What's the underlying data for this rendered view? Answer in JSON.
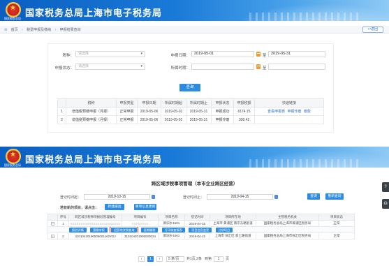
{
  "brand": {
    "title": "国家税务总局上海市电子税务局",
    "emblem_caption": "国家税务总局"
  },
  "panel1": {
    "breadcrumb": [
      "首页",
      "税费申报及缴纳",
      "申报结果查询"
    ],
    "back_label": "返回",
    "form": {
      "tax_type_label": "税种：",
      "tax_type_placeholder": "请选择",
      "declare_status_label": "申报状态：",
      "declare_status_placeholder": "请选择",
      "declare_date_label": "申报日期：",
      "declare_date_from": "2019-05-01",
      "declare_date_to": "2019-05-31",
      "period_label": "所属时期：",
      "period_from": "",
      "period_to": "",
      "to_label": "至"
    },
    "query_label": "查询",
    "table": {
      "headers": [
        "",
        "税种",
        "申报类型",
        "申报日期",
        "所属时期起",
        "所属时期止",
        "申报状态",
        "申报税额",
        "快速链接"
      ],
      "rows": [
        {
          "no": "1",
          "tax": "增值税预缴申报（月报）",
          "type": "正常申报",
          "date": "2019-05-06",
          "start": "2019-05-01",
          "end": "2019-05-31",
          "status": "申报成功",
          "amount": "6174.75",
          "links": [
            "查看申报表",
            "申报作废",
            "缴款"
          ]
        },
        {
          "no": "2",
          "tax": "增值税预缴申报（月报）",
          "type": "正常申报",
          "date": "2019-05-06",
          "start": "2019-05-01",
          "end": "2019-05-31",
          "status": "申报作废",
          "amount": "308.42",
          "links": []
        }
      ]
    }
  },
  "panel2": {
    "title": "跨区域涉税事项管理（本市企业跨区经营）",
    "start_label": "登记时间起：",
    "start_value": "2019-10-15",
    "end_label": "登记时间止：",
    "end_value": "2019-04-15",
    "query_label": "查询",
    "reset_label": "重新查询",
    "hint_label": "若有新的项目，请点击：",
    "new_report_label": "新建报验",
    "new_register_label": "事项信息更新",
    "table": {
      "headers": [
        "",
        "序号",
        "跨区域涉税事项报验管理编号",
        "项目编号",
        "项目名称",
        "登记时间",
        "项目所在地",
        "主管税务机关",
        "项目状态"
      ],
      "rows": [
        {
          "no": "1",
          "code": "XXXXXXXXXXXXXXXXXXXXXXXX",
          "item": "XXXXXXXX",
          "name": "新旧乡1601",
          "time": "2019-04-15",
          "place": "上海市 黄浦区 南京东路街道",
          "office": "国家税务总局上海市黄浦区税务局",
          "state": "正常"
        },
        {
          "no": "2",
          "code": "31010420190506001162YDJ",
          "item": "310104201905000024",
          "name": "新旧乡1601",
          "time": "2019-04-15",
          "place": "上海市 徐汇区 斜土路街道",
          "office": "国家税务总局上海市徐汇区税务局",
          "state": "正常"
        }
      ],
      "actions": [
        "报验详情",
        "预缴申报",
        "经营地涉税查询",
        "延期缴税",
        "打印核查报表",
        "项目信息变更",
        "注销项目"
      ]
    },
    "pager": {
      "prev": "‹",
      "page": "1",
      "next": "›",
      "page_size": "5 条/页",
      "total": "共1页,2条",
      "goto_label": "到第",
      "goto_value": "1",
      "page_unit": "页"
    }
  }
}
